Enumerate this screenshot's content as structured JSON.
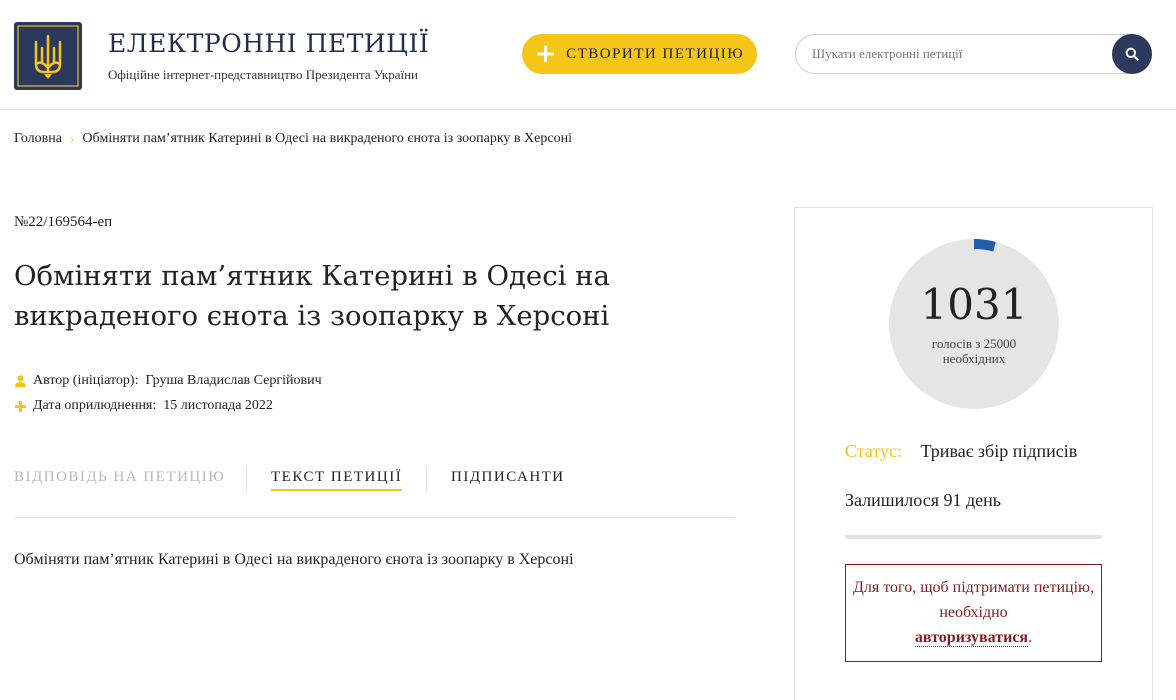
{
  "header": {
    "title": "ЕЛЕКТРОННІ ПЕТИЦІЇ",
    "subtitle": "Офіційне інтернет-представництво Президента України",
    "create_button": "СТВОРИТИ ПЕТИЦІЮ",
    "search_placeholder": "Шукати електронні петиції",
    "logo_icon": "trident-icon",
    "brand_color": "#2b3a5c",
    "accent_color": "#f5c518"
  },
  "breadcrumb": {
    "home": "Головна",
    "current": "Обміняти пам’ятник Катерині в Одесі на викраденого єнота із зоопарку в Херсоні"
  },
  "petition": {
    "number": "№22/169564-еп",
    "title": "Обміняти пам’ятник Катерині в Одесі на викраденого єнота із зоопарку в Херсоні",
    "author_label": "Автор (ініціатор):",
    "author": "Груша Владислав Сергійович",
    "date_label": "Дата оприлюднення:",
    "date": "15 листопада 2022",
    "text": "Обміняти пам’ятник Катерині в Одесі на викраденого єнота із зоопарку в Херсоні"
  },
  "tabs": {
    "answer": "ВІДПОВІДЬ НА ПЕТИЦІЮ",
    "text": "ТЕКСТ ПЕТИЦІЇ",
    "signers": "ПІДПИСАНТИ"
  },
  "sidebar": {
    "votes": "1031",
    "votes_label": "голосів з 25000 необхідних",
    "votes_count": 1031,
    "votes_needed": 25000,
    "status_label": "Статус:",
    "status_value": "Триває збір підписів",
    "remaining": "Залишилося 91 день",
    "auth_text_before": "Для того, щоб підтримати петицію, необхідно",
    "auth_link": "авторизуватися",
    "auth_text_after": "."
  }
}
